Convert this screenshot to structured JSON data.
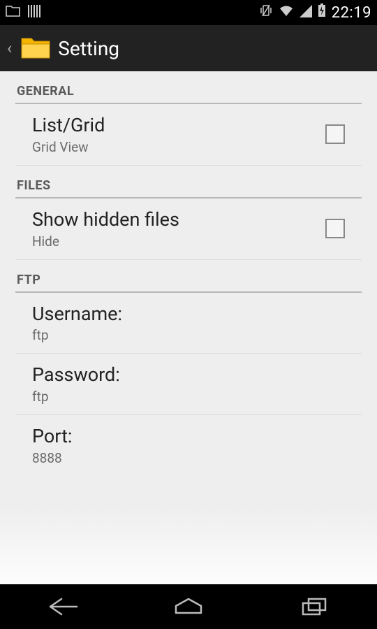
{
  "status": {
    "time": "22:19"
  },
  "header": {
    "title": "Setting"
  },
  "sections": {
    "general": {
      "header": "GENERAL",
      "listgrid": {
        "title": "List/Grid",
        "summary": "Grid View"
      }
    },
    "files": {
      "header": "FILES",
      "hidden": {
        "title": "Show hidden files",
        "summary": "Hide"
      }
    },
    "ftp": {
      "header": "FTP",
      "username": {
        "title": "Username:",
        "summary": "ftp"
      },
      "password": {
        "title": "Password:",
        "summary": "ftp"
      },
      "port": {
        "title": "Port:",
        "summary": "8888"
      }
    }
  }
}
